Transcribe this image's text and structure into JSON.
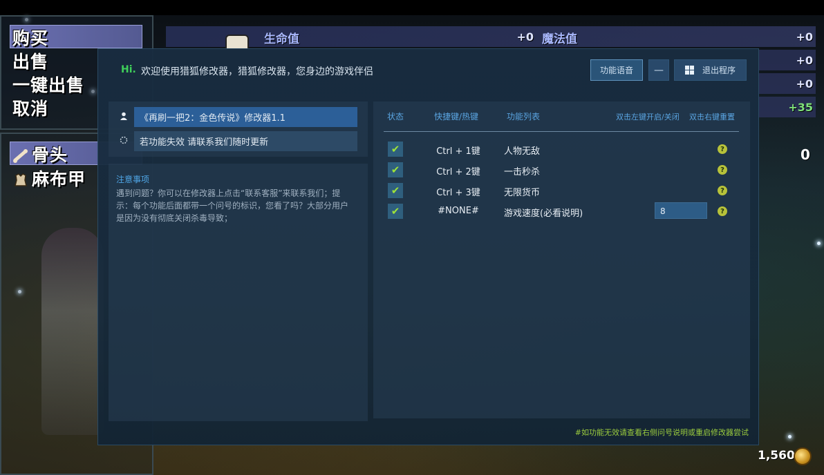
{
  "game": {
    "menu": [
      "购买",
      "出售",
      "一键出售",
      "取消"
    ],
    "inventory": [
      {
        "label": "骨头",
        "icon": "bone-icon"
      },
      {
        "label": "麻布甲",
        "icon": "cloth-armor-icon"
      }
    ],
    "stats": {
      "hp_label": "生命值",
      "hp_value": "+0",
      "mp_label": "魔法值",
      "mp_value": "+0",
      "extra_values": [
        "+0",
        "+0",
        "+35"
      ]
    },
    "item_count": "0",
    "gold": "1,560"
  },
  "trainer": {
    "hi": "Hi.",
    "welcome": "欢迎使用猎狐修改器，猎狐修改器，您身边的游戏伴侣",
    "buttons": {
      "voice": "功能语音",
      "minimize": "—",
      "exit": "退出程序"
    },
    "game_title": "《再刷一把2：金色传说》修改器1.1",
    "update_hint": "若功能失效 请联系我们随时更新",
    "notes_title": "注意事项",
    "notes_body": "遇到问题？你可以在修改器上点击“联系客服”来联系我们；提示：每个功能后面都带一个问号的标识，您看了吗？大部分用户是因为没有彻底关闭杀毒导致；",
    "table_headers": {
      "status": "状态",
      "hotkey": "快捷键/热键",
      "features": "功能列表",
      "toggle_hint": "双击左键开启/关闭",
      "reset_hint": "双击右键重置"
    },
    "cheats": [
      {
        "checked": "✔",
        "hotkey": "Ctrl + 1键",
        "name": "人物无敌",
        "help": "?"
      },
      {
        "checked": "✔",
        "hotkey": "Ctrl + 2键",
        "name": "一击秒杀",
        "help": "?"
      },
      {
        "checked": "✔",
        "hotkey": "Ctrl + 3键",
        "name": "无限货币",
        "help": "?"
      },
      {
        "checked": "✔",
        "hotkey": "#NONE#",
        "name": "游戏速度(必看说明)",
        "help": "?",
        "input_value": "8"
      }
    ],
    "footer": "#如功能无效请查看右侧问号说明或重启修改器尝试"
  }
}
